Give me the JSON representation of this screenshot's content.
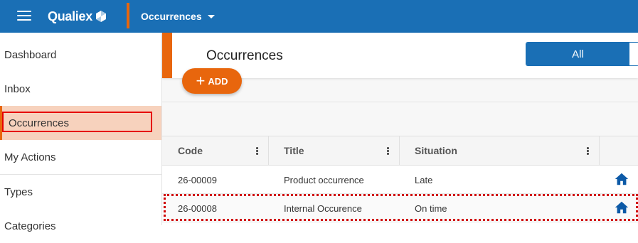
{
  "topbar": {
    "brand": "Qualiex",
    "module": "Occurrences",
    "bg_color": "#1a6fb5",
    "accent_color": "#e8660d",
    "icons": [
      "menu-icon",
      "qualiex-logo-icon",
      "chevron-down-icon"
    ]
  },
  "sidebar": {
    "items": [
      {
        "label": "Dashboard"
      },
      {
        "label": "Inbox"
      },
      {
        "label": "Occurrences",
        "active": true
      },
      {
        "label": "My Actions"
      },
      {
        "label": "Types"
      },
      {
        "label": "Categories"
      }
    ]
  },
  "header": {
    "title": "Occurrences",
    "filter_all": "All",
    "add_label": "ADD",
    "add_icon": "plus-icon"
  },
  "table": {
    "columns": [
      "Code",
      "Title",
      "Situation",
      ""
    ],
    "rows": [
      {
        "code": "26-00009",
        "title": "Product occurrence",
        "situation": "Late",
        "icon": "home-icon"
      },
      {
        "code": "26-00008",
        "title": "Internal Occurence",
        "situation": "On time",
        "icon": "home-icon",
        "highlighted": true
      }
    ],
    "icon_color": "#0d5aa7"
  }
}
